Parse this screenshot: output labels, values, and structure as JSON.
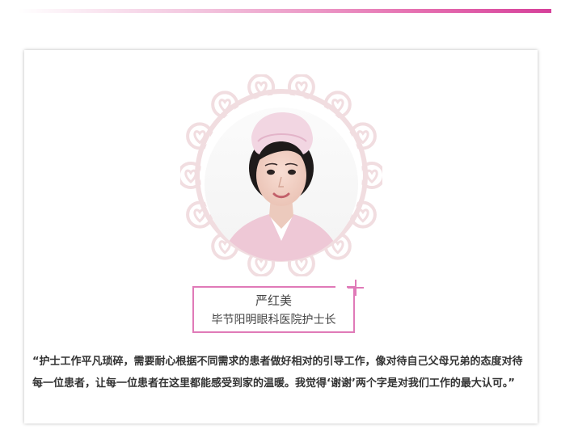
{
  "profile": {
    "name": "严红美",
    "title": "毕节阳明眼科医院护士长"
  },
  "quote": {
    "text": "“护士工作平凡琐碎，需要耐心根据不同需求的患者做好相对的引导工作，像对待自己父母兄弟的态度对待每一位患者，让每一位患者在这里都能感受到家的温暖。我觉得‘谢谢’两个字是对我们工作的最大认可。”"
  },
  "colors": {
    "accent": "#e07ab8",
    "bar_end": "#d6409a",
    "frame": "#f1dde0",
    "text": "#333333"
  },
  "icons": {
    "frame": "lace-frame-icon",
    "plus": "plus-icon"
  }
}
